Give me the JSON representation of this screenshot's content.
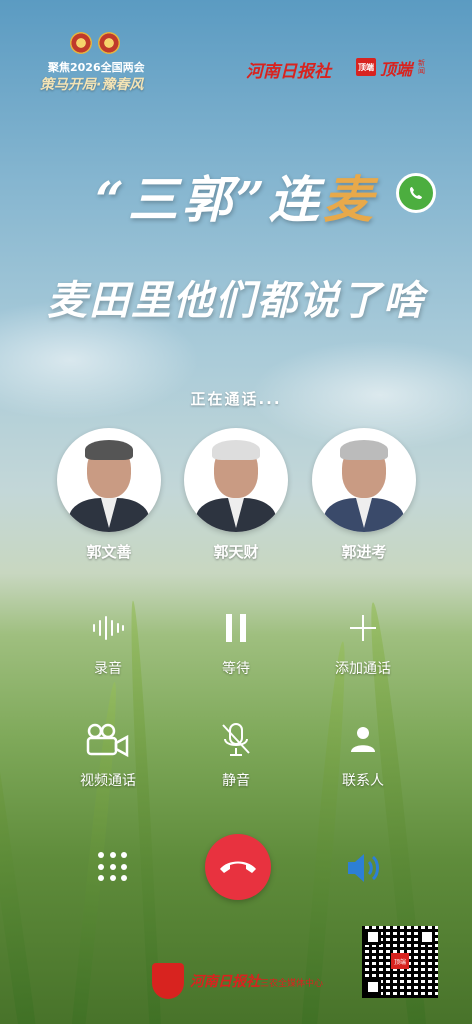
{
  "header": {
    "event_line1": "聚焦2026全国两会",
    "event_line2": "策马开局·豫春风",
    "brand_newspaper": "河南日报社",
    "brand_app_badge": "顶端",
    "brand_app": "顶端",
    "brand_app_sub": "新闻"
  },
  "title": {
    "line1_quote_open": "“",
    "line1_part1": "三郭",
    "line1_quote_close": "”",
    "line1_part2": "连",
    "line1_part3": "麦",
    "line2": "麦田里他们都说了啥"
  },
  "call": {
    "status": "正在通话...",
    "participants": [
      {
        "name": "郭文善"
      },
      {
        "name": "郭天财"
      },
      {
        "name": "郭进考"
      }
    ]
  },
  "controls": {
    "record": "录音",
    "hold": "等待",
    "add_call": "添加通话",
    "video_call": "视频通话",
    "mute": "静音",
    "contacts": "联系人"
  },
  "footer": {
    "org": "河南日报社",
    "org_sub": "三农全媒体中心",
    "qr_badge": "顶端"
  },
  "colors": {
    "brand_red": "#d8231f",
    "end_call_red": "#e8323f",
    "title_gold": "#e8a94a",
    "speaker_blue": "#2d7fd6"
  }
}
